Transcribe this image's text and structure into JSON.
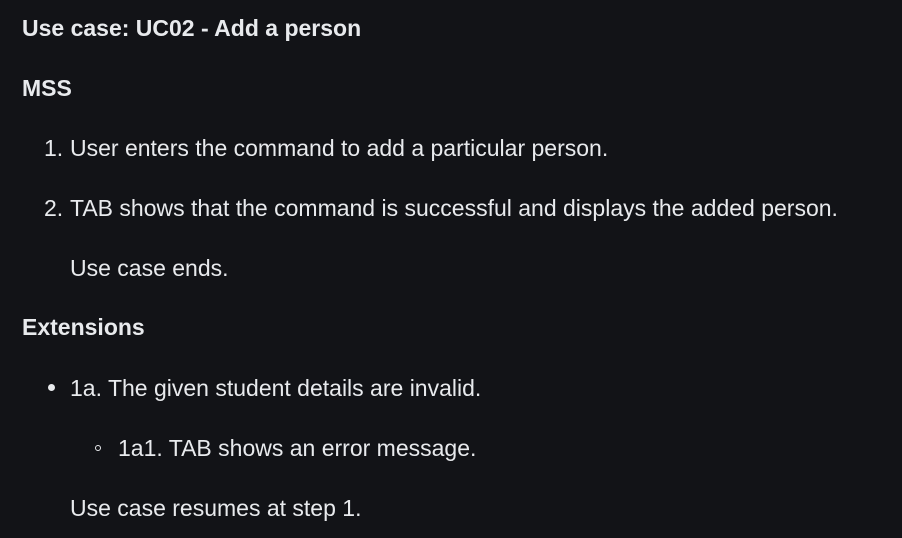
{
  "heading": "Use case: UC02 - Add a person",
  "mss": {
    "title": "MSS",
    "steps": [
      {
        "number": "1.",
        "text": "User enters the command to add a particular person."
      },
      {
        "number": "2.",
        "text": "TAB shows that the command is successful and displays the added person."
      }
    ],
    "ending": "Use case ends."
  },
  "extensions": {
    "title": "Extensions",
    "items": [
      {
        "text": "1a. The given student details are invalid.",
        "subitems": [
          "1a1. TAB shows an error message."
        ],
        "resume": "Use case resumes at step 1."
      }
    ]
  }
}
